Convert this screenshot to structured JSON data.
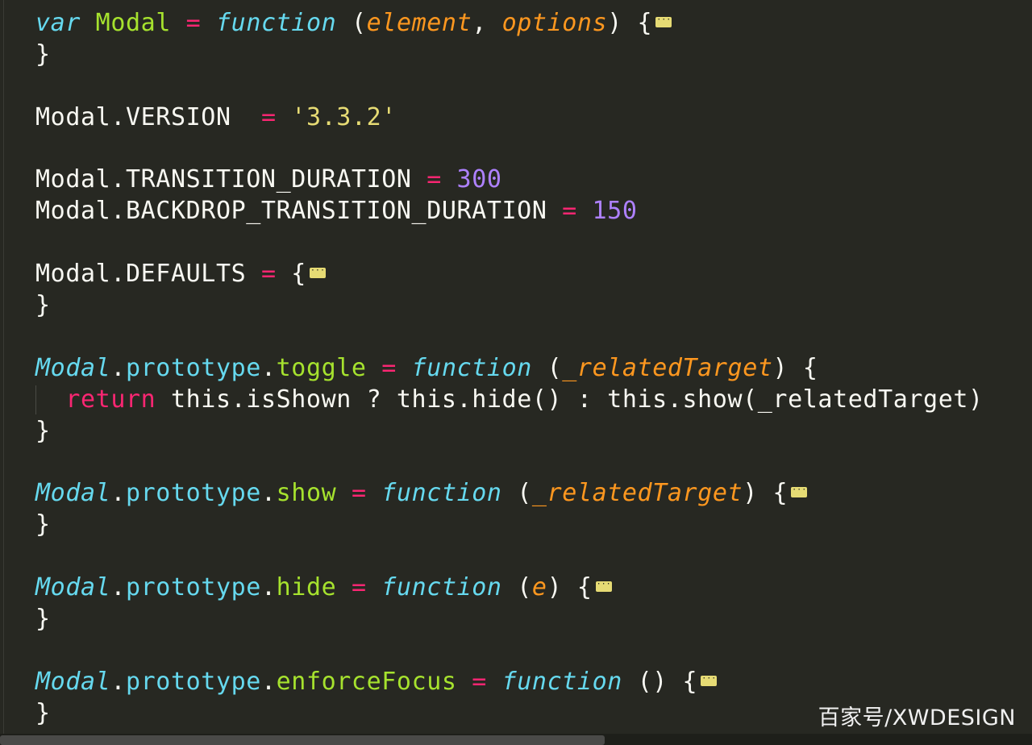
{
  "editor": {
    "theme_colors": {
      "background": "#272822",
      "keyword": "#66d9ef",
      "operator": "#f92672",
      "name": "#a6e22e",
      "param": "#fd971f",
      "string": "#e6db74",
      "number": "#ae81ff",
      "text": "#f8f8f2"
    },
    "lines": {
      "l1": {
        "kw": "var",
        "name": "Modal",
        "op": "=",
        "fn": "function",
        "open": " (",
        "p1": "element",
        "sep": ", ",
        "p2": "options",
        "close": ") {"
      },
      "l2": {
        "text": "}"
      },
      "l4": {
        "obj": "Modal.VERSION  ",
        "op": "=",
        "str": "'3.3.2'"
      },
      "l6": {
        "obj": "Modal.TRANSITION_DURATION ",
        "op": "=",
        "num": "300"
      },
      "l7": {
        "obj": "Modal.BACKDROP_TRANSITION_DURATION ",
        "op": "=",
        "num": "150"
      },
      "l9": {
        "obj": "Modal.DEFAULTS ",
        "op": "=",
        "close": " {"
      },
      "l10": {
        "text": "}"
      },
      "l12": {
        "cls": "Modal",
        "dot": ".",
        "proto": "prototype",
        "dot2": ".",
        "method": "toggle",
        "op": "=",
        "fn": "function",
        "open": " (",
        "p1": "_relatedTarget",
        "close": ") {"
      },
      "l13": {
        "ret": "return",
        "body": " this.isShown ? this.hide() : this.show(_relatedTarget)"
      },
      "l14": {
        "text": "}"
      },
      "l16": {
        "cls": "Modal",
        "dot": ".",
        "proto": "prototype",
        "dot2": ".",
        "method": "show",
        "op": "=",
        "fn": "function",
        "open": " (",
        "p1": "_relatedTarget",
        "close": ") {"
      },
      "l17": {
        "text": "}"
      },
      "l19": {
        "cls": "Modal",
        "dot": ".",
        "proto": "prototype",
        "dot2": ".",
        "method": "hide",
        "op": "=",
        "fn": "function",
        "open": " (",
        "p1": "e",
        "close": ") {"
      },
      "l20": {
        "text": "}"
      },
      "l22": {
        "cls": "Modal",
        "dot": ".",
        "proto": "prototype",
        "dot2": ".",
        "method": "enforceFocus",
        "op": "=",
        "fn": "function",
        "open": " ",
        "close": "() {"
      },
      "l23": {
        "text": "}"
      }
    },
    "fold_marker": "···"
  },
  "watermark": "百家号/XWDESIGN"
}
